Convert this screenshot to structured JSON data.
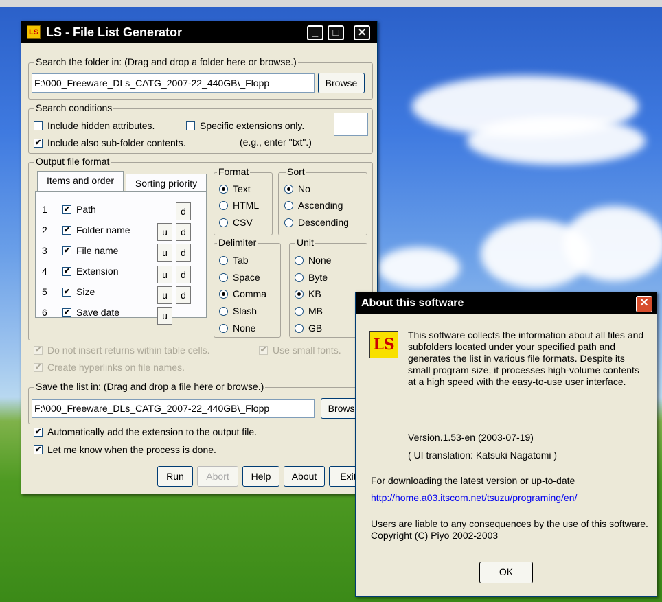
{
  "main": {
    "title": "LS - File List Generator",
    "window_buttons": {
      "minimize": "_",
      "maximize": "□",
      "close": "✕"
    },
    "search_group": "Search the folder in: (Drag and drop a folder here or browse.)",
    "search_path": "F:\\000_Freeware_DLs_CATG_2007-22_440GB\\_Flopp",
    "browse_label": "Browse",
    "conditions_group": "Search conditions",
    "include_hidden": "Include hidden attributes.",
    "specific_ext": "Specific extensions only.",
    "include_sub": "Include also sub-folder contents.",
    "ext_example": "(e.g., enter \"txt\".)",
    "output_group": "Output file format",
    "tabs": [
      "Items and order",
      "Sorting priority"
    ],
    "items": [
      {
        "num": "1",
        "label": "Path"
      },
      {
        "num": "2",
        "label": "Folder name"
      },
      {
        "num": "3",
        "label": "File name"
      },
      {
        "num": "4",
        "label": "Extension"
      },
      {
        "num": "5",
        "label": "Size"
      },
      {
        "num": "6",
        "label": "Save date"
      }
    ],
    "u": "u",
    "d": "d",
    "format_group": "Format",
    "format_opts": [
      "Text",
      "HTML",
      "CSV"
    ],
    "sort_group": "Sort",
    "sort_opts": [
      "No",
      "Ascending",
      "Descending"
    ],
    "delimiter_group": "Delimiter",
    "delimiter_opts": [
      "Tab",
      "Space",
      "Comma",
      "Slash",
      "None"
    ],
    "unit_group": "Unit",
    "unit_opts": [
      "None",
      "Byte",
      "KB",
      "MB",
      "GB"
    ],
    "no_returns": "Do not insert returns within table cells.",
    "small_fonts": "Use small fonts.",
    "hyperlinks": "Create hyperlinks on file names.",
    "save_group": "Save the list in: (Drag and drop a file here or browse.)",
    "save_path": "F:\\000_Freeware_DLs_CATG_2007-22_440GB\\_Flopp",
    "browse2_label": "Browse",
    "auto_ext": "Automatically add the extension to the output file.",
    "notify": "Let me know when the process is done.",
    "run": "Run",
    "abort": "Abort",
    "help": "Help",
    "about": "About",
    "exit": "Exit"
  },
  "about": {
    "title": "About this software",
    "close": "✕",
    "logo": "LS",
    "description": "This software collects the information about all files and subfolders located under your specified path and generates the list in various file formats. Despite its small program size, it processes high-volume contents at a high speed with the easy-to-use user interface.",
    "version": "Version.1.53-en (2003-07-19)",
    "translation": "( UI translation: Katsuki Nagatomi )",
    "download_text": "For downloading the latest version or up-to-date",
    "url": "http://home.a03.itscom.net/tsuzu/programing/en/",
    "disclaimer": "Users are liable to any consequences by the use of this software. Copyright (C) Piyo 2002-2003",
    "ok": "OK"
  }
}
